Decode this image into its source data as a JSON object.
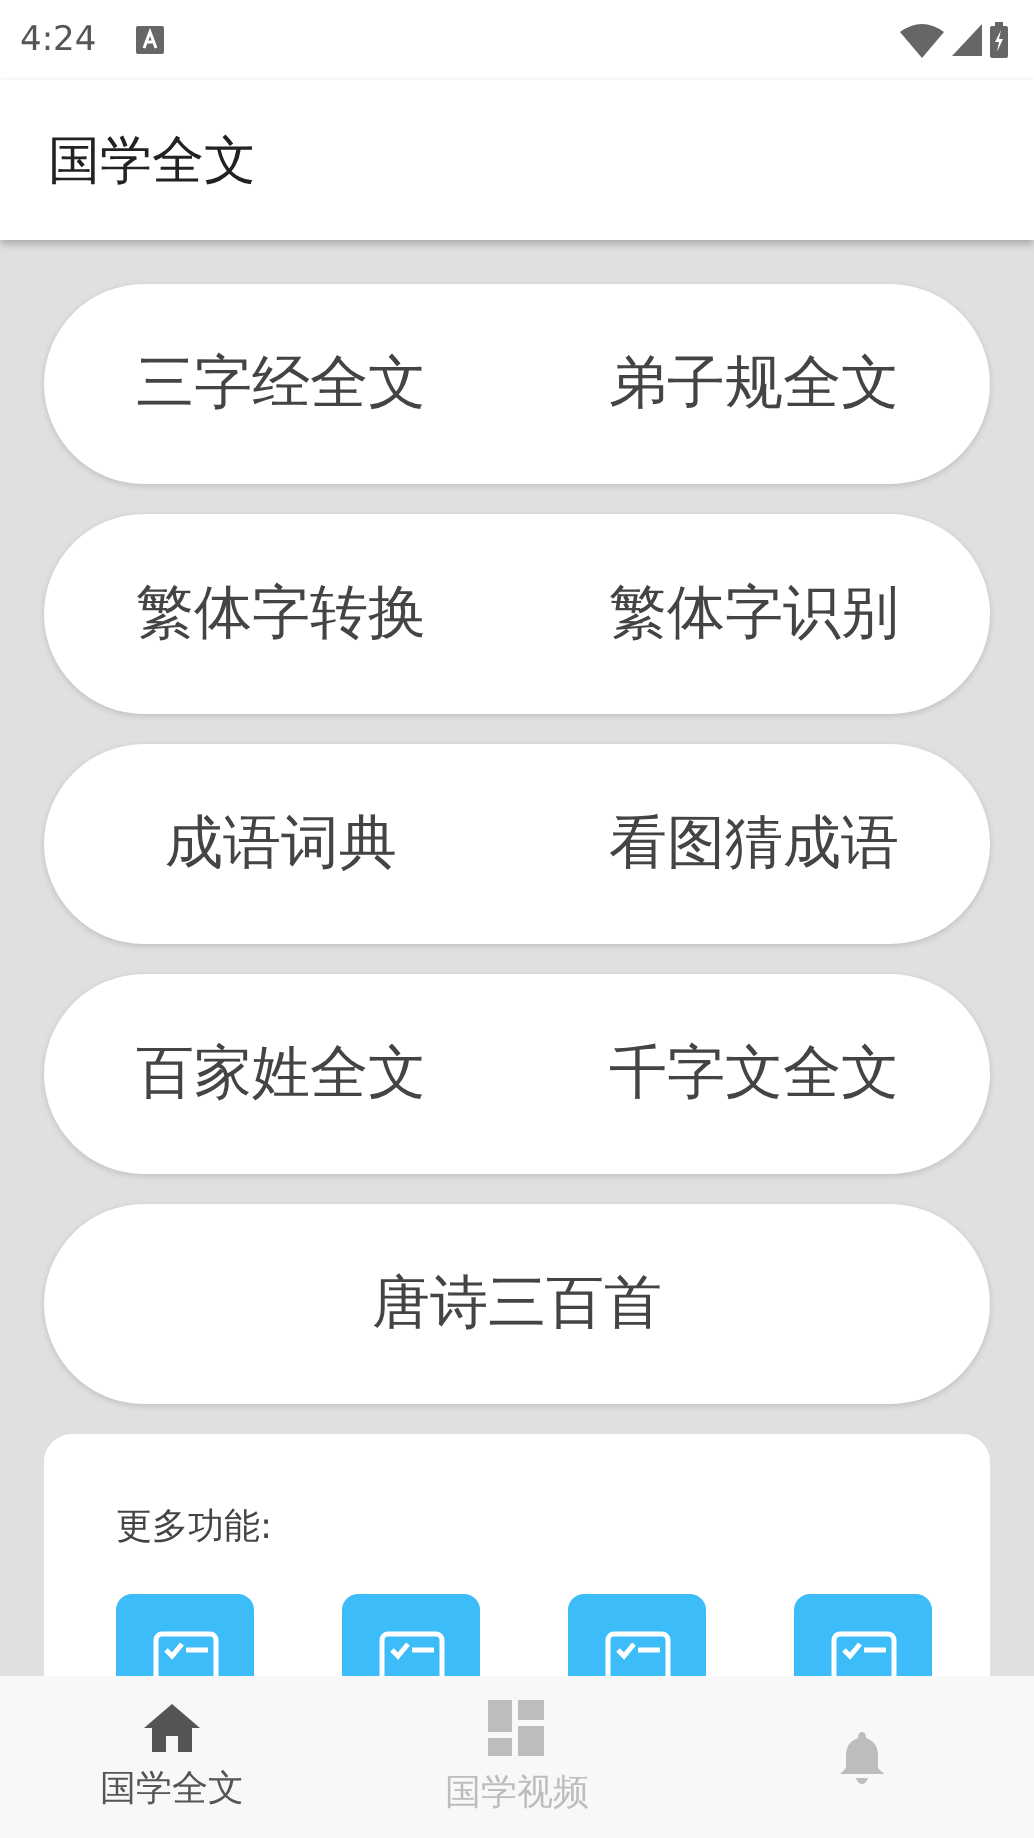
{
  "status_bar": {
    "time": "4:24"
  },
  "app_bar": {
    "title": "国学全文"
  },
  "menu_rows": [
    {
      "items": [
        "三字经全文",
        "弟子规全文"
      ]
    },
    {
      "items": [
        "繁体字转换",
        "繁体字识别"
      ]
    },
    {
      "items": [
        "成语词典",
        "看图猜成语"
      ]
    },
    {
      "items": [
        "百家姓全文",
        "千字文全文"
      ]
    },
    {
      "items": [
        "唐诗三百首"
      ]
    }
  ],
  "more_section": {
    "title": "更多功能:",
    "tiles": [
      {
        "kind": "checklist"
      },
      {
        "kind": "checklist"
      },
      {
        "kind": "checklist"
      },
      {
        "kind": "checklist"
      }
    ]
  },
  "bottom_nav": [
    {
      "kind": "home",
      "label": "国学全文",
      "selected": true
    },
    {
      "kind": "grid",
      "label": "国学视频",
      "selected": false
    },
    {
      "kind": "bell",
      "selected": false
    }
  ]
}
